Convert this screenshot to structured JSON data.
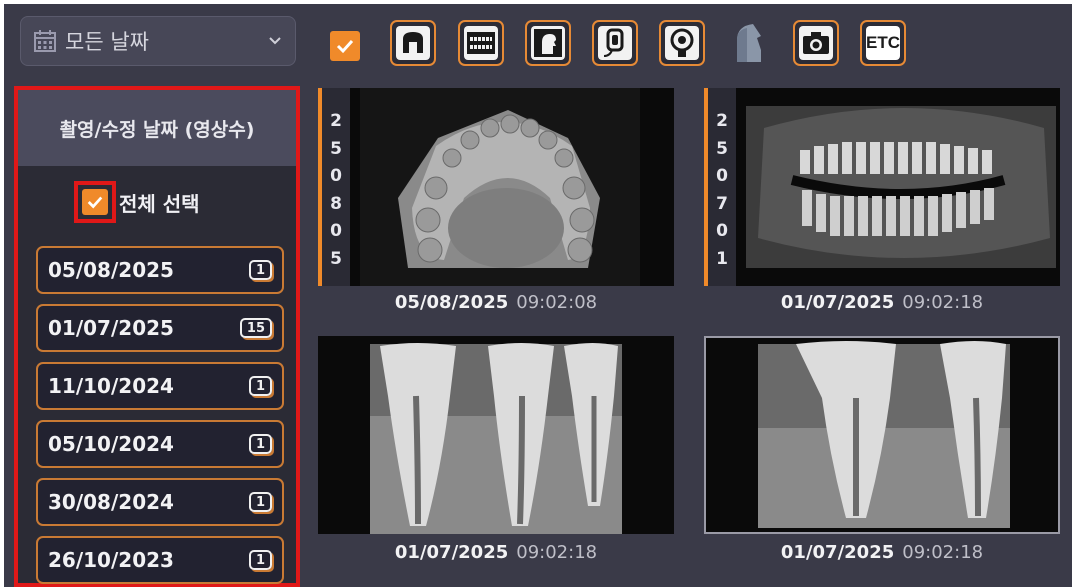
{
  "toolbar": {
    "date_filter": "모든 날짜",
    "etc_label": "ETC",
    "icons": [
      "select-all-checkbox",
      "skull-icon",
      "teeth-arch-icon",
      "cephalo-icon",
      "sensor-icon",
      "model-scanner-icon",
      "cbct-icon",
      "camera-icon",
      "etc-icon"
    ]
  },
  "sidebar": {
    "header": "촬영/수정 날짜 (영상수)",
    "select_all_label": "전체 선택",
    "dates": [
      {
        "date": "05/08/2025",
        "count": "1"
      },
      {
        "date": "01/07/2025",
        "count": "15"
      },
      {
        "date": "11/10/2024",
        "count": "1"
      },
      {
        "date": "05/10/2024",
        "count": "1"
      },
      {
        "date": "30/08/2024",
        "count": "1"
      },
      {
        "date": "26/10/2023",
        "count": "1"
      }
    ]
  },
  "thumbnails": [
    {
      "id_digits": "250805",
      "date": "05/08/2025",
      "time": "09:02:08",
      "kind": "dental-model-scan"
    },
    {
      "id_digits": "250701",
      "date": "01/07/2025",
      "time": "09:02:18",
      "kind": "panoramic-xray"
    },
    {
      "date": "01/07/2025",
      "time": "09:02:18",
      "kind": "periapical-xray"
    },
    {
      "date": "01/07/2025",
      "time": "09:02:18",
      "kind": "periapical-xray"
    }
  ],
  "colors": {
    "accent": "#f08a2a",
    "highlight": "#e01818",
    "background": "#3a3a48"
  }
}
